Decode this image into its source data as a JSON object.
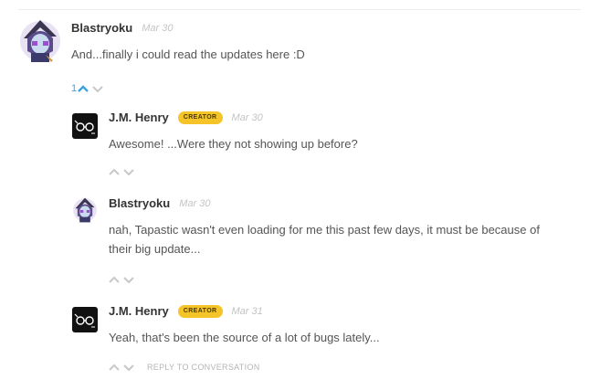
{
  "thread": {
    "root": {
      "author": "Blastryoku",
      "date": "Mar 30",
      "text": "And...finally i could read the updates here :D",
      "vote_count": "1",
      "avatar": "anime-character-avatar"
    },
    "replies": [
      {
        "author": "J.M. Henry",
        "badge": "CREATOR",
        "date": "Mar 30",
        "text": "Awesome! ...Were they not showing up before?",
        "avatar": "glasses-logo-avatar"
      },
      {
        "author": "Blastryoku",
        "date": "Mar 30",
        "text_line1": "nah, Tapastic wasn't even loading for me this past few days, it must be because of",
        "text_line2": "their big update...",
        "avatar": "anime-character-avatar"
      },
      {
        "author": "J.M. Henry",
        "badge": "CREATOR",
        "date": "Mar 31",
        "text": "Yeah, that's been the source of a lot of bugs lately...",
        "avatar": "glasses-logo-avatar"
      }
    ],
    "reply_link": "REPLY TO CONVERSATION"
  },
  "colors": {
    "badge": "#f4c428",
    "vote_active": "#3da3e0",
    "vote_inactive": "#c8c8c8",
    "author": "#333333",
    "body_text": "#555555",
    "date": "#c4c4c4"
  },
  "icons": {
    "upvote": "chevron-up-icon",
    "downvote": "chevron-down-icon"
  }
}
